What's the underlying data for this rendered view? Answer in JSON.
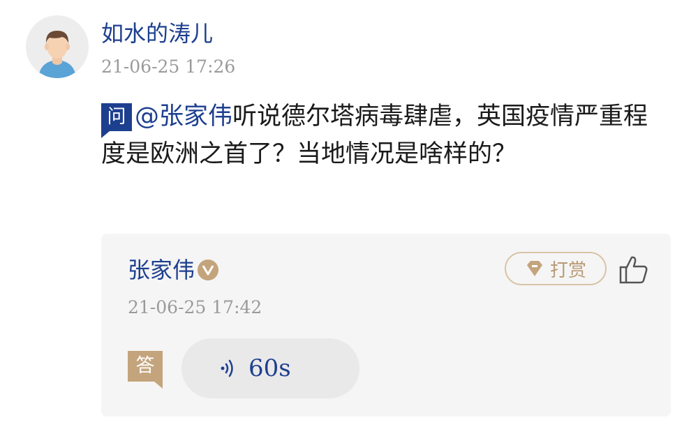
{
  "question": {
    "asker_name": "如水的涛儿",
    "timestamp": "21-06-25 17:26",
    "tag": "问",
    "mention": "@张家伟",
    "text": "听说德尔塔病毒肆虐，英国疫情严重程度是欧洲之首了？当地情况是啥样的？",
    "avatar_icon": "user-avatar-icon"
  },
  "answer": {
    "answerer_name": "张家伟",
    "verified_icon": "verified-v-icon",
    "timestamp": "21-06-25 17:42",
    "tip_label": "打赏",
    "tip_icon": "diamond-coin-icon",
    "like_icon": "thumbs-up-icon",
    "tag": "答",
    "audio_duration": "60s",
    "audio_icon": "sound-wave-icon"
  },
  "colors": {
    "primary_blue": "#1d3f8f",
    "gold": "#c4a47c",
    "muted_gray": "#9a9a9a",
    "card_bg": "#f5f5f5"
  }
}
